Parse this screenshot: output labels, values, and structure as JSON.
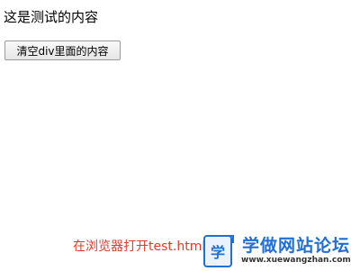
{
  "content": {
    "text": "这是测试的内容"
  },
  "button": {
    "label": "清空div里面的内容"
  },
  "caption": {
    "text": "在浏览器打开test.html文件"
  },
  "watermark": {
    "title": "学做网站论坛",
    "url": "www.xuewangzhan.com",
    "logo_glyph": "学",
    "color": "#1f6fd6"
  },
  "colors": {
    "caption": "#e03a2f",
    "background": "#ffffff"
  }
}
